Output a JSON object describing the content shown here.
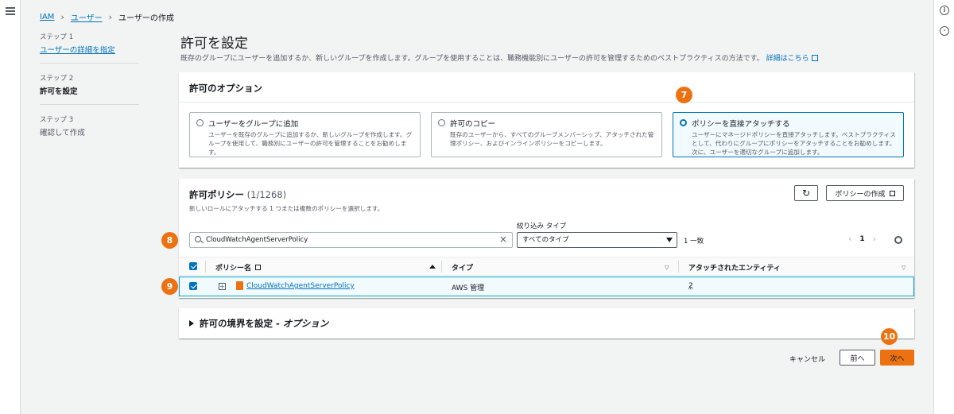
{
  "breadcrumb": {
    "root": "IAM",
    "users": "ユーザー",
    "current": "ユーザーの作成"
  },
  "steps": [
    {
      "num": "ステップ 1",
      "label": "ユーザーの詳細を指定"
    },
    {
      "num": "ステップ 2",
      "label": "許可を設定"
    },
    {
      "num": "ステップ 3",
      "label": "確認して作成"
    }
  ],
  "page": {
    "title": "許可を設定",
    "description": "既存のグループにユーザーを追加するか、新しいグループを作成します。グループを使用することは、職務機能別にユーザーの許可を管理するためのベストプラクティスの方法です。",
    "learn_more": "詳細はこちら"
  },
  "options": {
    "title": "許可のオプション",
    "tiles": [
      {
        "label": "ユーザーをグループに追加",
        "desc": "ユーザーを既存のグループに追加するか、新しいグループを作成します。グループを使用して、職務別にユーザーの許可を管理することをお勧めします。",
        "selected": false
      },
      {
        "label": "許可のコピー",
        "desc": "既存のユーザーから、すべてのグループメンバーシップ、アタッチされた管理ポリシー、およびインラインポリシーをコピーします。",
        "selected": false
      },
      {
        "label": "ポリシーを直接アタッチする",
        "desc": "ユーザーにマネージドポリシーを直接アタッチします。ベストプラクティスとして、代わりにグループにポリシーをアタッチすることをお勧めします。次に、ユーザーを適切なグループに追加します。",
        "selected": true
      }
    ]
  },
  "policies": {
    "title": "許可ポリシー",
    "count": "(1/1268)",
    "subtitle": "新しいロールにアタッチする 1 つまたは複数のポリシーを選択します。",
    "create_button": "ポリシーの作成",
    "filter_label": "絞り込み タイプ",
    "search_value": "CloudWatchAgentServerPolicy",
    "type_select": "すべてのタイプ",
    "match_count": "1 一致",
    "page_number": "1",
    "columns": {
      "name": "ポリシー名",
      "type": "タイプ",
      "entities": "アタッチされたエンティティ"
    },
    "rows": [
      {
        "name": "CloudWatchAgentServerPolicy",
        "type": "AWS 管理",
        "entities": "2"
      }
    ]
  },
  "boundary": {
    "title": "許可の境界を設定 - ",
    "optional": "オプション"
  },
  "footer": {
    "cancel": "キャンセル",
    "prev": "前へ",
    "next": "次へ"
  },
  "badges": {
    "b7": "7",
    "b8": "8",
    "b9": "9",
    "b10": "10"
  },
  "colors": {
    "accent": "#0073bb",
    "primary_button": "#ec7211",
    "badge": "#ec7211"
  }
}
